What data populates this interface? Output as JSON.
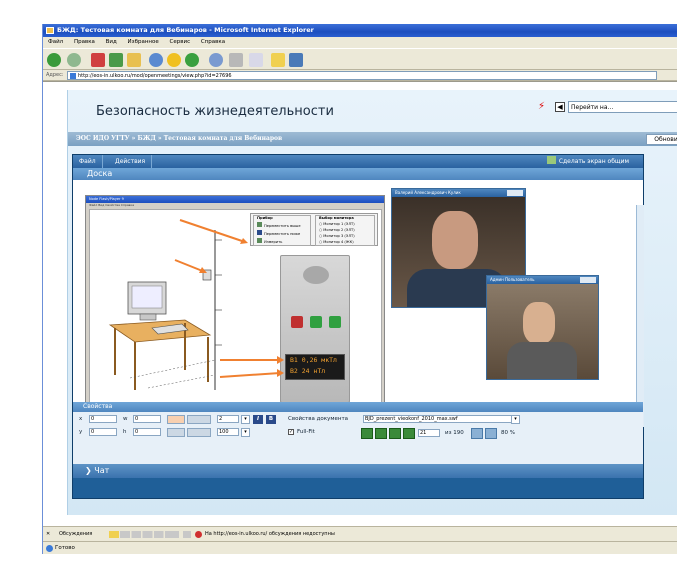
{
  "window": {
    "title": "БЖД: Тестовая комната для Вебинаров - Microsoft Internet Explorer"
  },
  "menu": [
    "Файл",
    "Правка",
    "Вид",
    "Избранное",
    "Сервис",
    "Справка"
  ],
  "address": {
    "label": "Адрес:",
    "url": "http://eos-in.ulkoo.ru/mod/openmeetings/view.php?id=27696"
  },
  "site": {
    "title": "Безопасность жизнедеятельности",
    "goto_placeholder": "Перейти на...",
    "breadcrumb": "ЭОС ИДО УГТУ » БЖД » Тестовая комната для Вебинаров",
    "refresh_button": "Обнови"
  },
  "meeting": {
    "menus": [
      "Файл",
      "Действия"
    ],
    "make_screen_shared": "Сделать экран общим",
    "board_title": "Доска",
    "slide": {
      "window_title": "Node Flash/Player 9",
      "menu": "Файл  Вид  Свойства  Справка",
      "panel_pribor_title": "Прибор",
      "panel_pribor_items": [
        "Переместить выше",
        "Переместить ниже",
        "Измерить"
      ],
      "panel_monitor_title": "Выбор монитора",
      "panel_monitor_items": [
        "Монитор 1 (ЭЛТ)",
        "Монитор 2 (ЭЛТ)",
        "Монитор 3 (ЭЛТ)",
        "Монитор 4 (ЖК)"
      ],
      "display_line1": "B1  0,26  мкТл",
      "display_line2": "B2  24   нТл"
    },
    "video1_title": "Валерий Александрович Кулик",
    "video2_title": "Админ Пользователь",
    "properties_label": "Свойства",
    "props": {
      "x_label": "x",
      "x_value": "0",
      "y_label": "y",
      "y_value": "0",
      "w_label": "w",
      "w_value": "0",
      "h_label": "h",
      "h_value": "0",
      "font_size": "2",
      "opacity": "100",
      "italic": "I",
      "bold": "B",
      "doc_props_label": "Свойства документа",
      "doc_name": "BJD_prezent_vieokonf_2010_max.swf",
      "fullfit_label": "Full-Fit",
      "page_current": "21",
      "page_total_label": "из 190",
      "zoom": "80 %"
    },
    "chat_label": "Чат"
  },
  "browser_bottom": {
    "discussions_label": "Обсуждения",
    "discussions_note": "На http://eos-in.ulkoo.ru/ обсуждения недоступны",
    "status": "Готово"
  },
  "colors": {
    "ie_blue": "#1d4fbf",
    "meeting_blue": "#1f5f98",
    "arrow_orange": "#f08030",
    "sidebar_bg": "#d3e7f4"
  }
}
